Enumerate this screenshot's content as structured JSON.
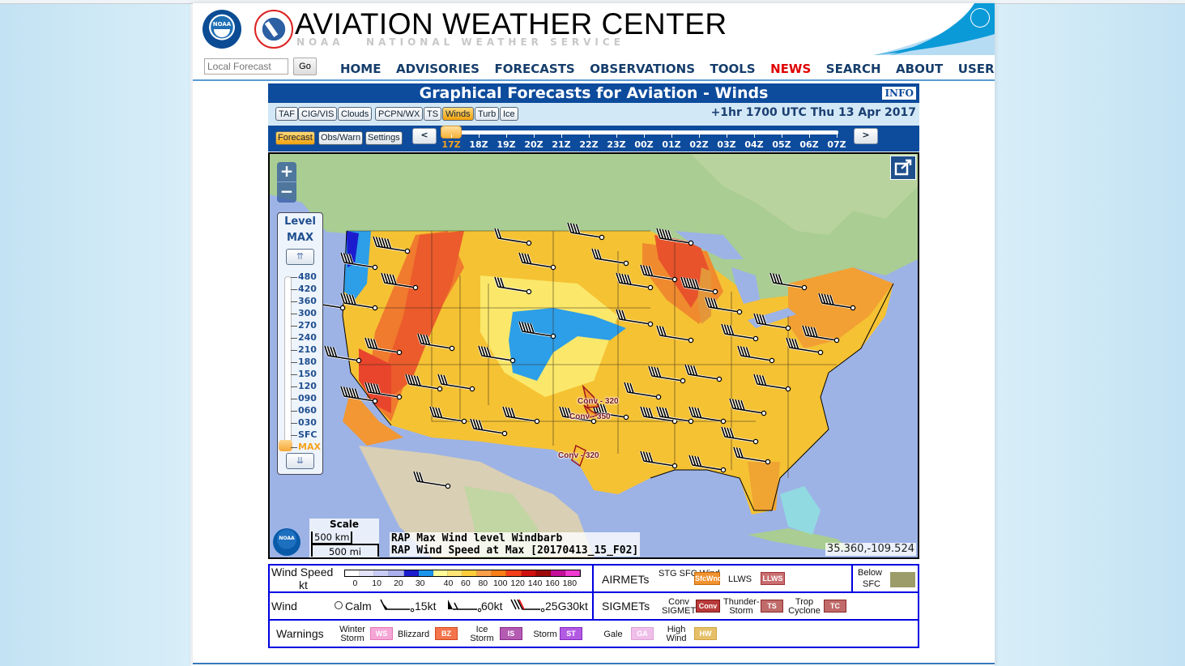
{
  "header": {
    "title": "AVIATION WEATHER CENTER",
    "subtitle": "NOAA   NATIONAL WEATHER SERVICE",
    "noaa_logo_text": "NOAA"
  },
  "nav": {
    "local_forecast_placeholder": "Local Forecast",
    "go_label": "Go",
    "links": [
      "HOME",
      "ADVISORIES",
      "FORECASTS",
      "OBSERVATIONS",
      "TOOLS",
      "NEWS",
      "SEARCH",
      "ABOUT",
      "USER"
    ],
    "highlight_color": "#e00000"
  },
  "tool": {
    "title": "Graphical Forecasts for Aviation - Winds",
    "info_label": "INFO",
    "products": [
      {
        "label": "TAF",
        "active": false
      },
      {
        "label": "CIG/VIS",
        "active": false
      },
      {
        "label": "Clouds",
        "active": false
      },
      {
        "label": "PCPN/WX",
        "active": false
      },
      {
        "label": "TS",
        "active": false
      },
      {
        "label": "Winds",
        "active": true
      },
      {
        "label": "Turb",
        "active": false
      },
      {
        "label": "Ice",
        "active": false
      }
    ],
    "valid_time": "+1hr 1700 UTC Thu 13 Apr 2017",
    "modes": [
      {
        "label": "Forecast",
        "active": true
      },
      {
        "label": "Obs/Warn",
        "active": false
      },
      {
        "label": "Settings",
        "active": false
      }
    ],
    "prev_label": "<",
    "next_label": ">",
    "times": [
      "17Z",
      "18Z",
      "19Z",
      "20Z",
      "21Z",
      "22Z",
      "23Z",
      "00Z",
      "01Z",
      "02Z",
      "03Z",
      "04Z",
      "05Z",
      "06Z",
      "07Z"
    ],
    "selected_time": "17Z"
  },
  "map": {
    "zoom_in": "+",
    "zoom_out": "−",
    "level_panel": {
      "title": "Level",
      "current": "MAX",
      "up_label": "⇈",
      "down_label": "⇊",
      "levels": [
        "480",
        "420",
        "360",
        "300",
        "270",
        "240",
        "210",
        "180",
        "150",
        "120",
        "090",
        "060",
        "030",
        "SFC",
        "MAX"
      ],
      "selected": "MAX"
    },
    "scale": {
      "title": "Scale",
      "km": "500 km",
      "mi": "500 mi"
    },
    "layers": [
      "RAP Max Wind level Windbarb",
      "RAP Wind Speed at Max [20170413_15_F02]"
    ],
    "coordinates": "35.360,-109.524",
    "convective_sigmets": [
      "Conv - 320",
      "Conv - 350",
      "Conv - 320"
    ],
    "noaa_logo_text": "NOAA"
  },
  "legend": {
    "wind_speed": {
      "label_line1": "Wind Speed",
      "label_line2": "kt",
      "colors": [
        "#ffffff",
        "#e3e3fb",
        "#c9cdf5",
        "#abb0ee",
        "#1c1ccf",
        "#1b95ec",
        "#fffd9a",
        "#ffe476",
        "#fdcd3b",
        "#fba049",
        "#f97e17",
        "#f5401c",
        "#d10f0f",
        "#9c0a0a",
        "#c30f9a",
        "#f03ad0"
      ],
      "ticks": [
        "0",
        "10",
        "20",
        "30",
        "40",
        "60",
        "80",
        "100",
        "120",
        "140",
        "160",
        "180"
      ]
    },
    "wind": {
      "label": "Wind",
      "items": [
        "Calm",
        "15kt",
        "60kt",
        "25G30kt"
      ]
    },
    "warnings": {
      "label": "Warnings",
      "items": [
        {
          "name": "Winter Storm",
          "code": "WS",
          "color": "#f5a6d6",
          "border": "#e27ab7"
        },
        {
          "name": "Blizzard",
          "code": "BZ",
          "color": "#f4744c",
          "border": "#d24a1e"
        },
        {
          "name": "Ice Storm",
          "code": "IS",
          "color": "#b45bb2",
          "border": "#8a2b8b"
        },
        {
          "name": "Storm",
          "code": "ST",
          "color": "#b35ae3",
          "border": "#8429c1"
        },
        {
          "name": "Gale",
          "code": "GA",
          "color": "#efbfe9",
          "border": "#dea2d6"
        },
        {
          "name": "High Wind",
          "code": "HW",
          "color": "#e6c068",
          "border": "#d1a444"
        }
      ]
    },
    "airmets": {
      "label": "AIRMETs",
      "items": [
        {
          "name": "STG SFC Wind",
          "code": "SfcWnd",
          "color": "#f0922f",
          "border": "#c86a0a"
        },
        {
          "name": "LLWS",
          "code": "LLWS",
          "color": "#c96e70",
          "border": "#9f3237"
        }
      ]
    },
    "below_sfc": {
      "label_line1": "Below",
      "label_line2": "SFC",
      "color": "#9c9c6a"
    },
    "sigmets": {
      "label": "SIGMETs",
      "items": [
        {
          "name": "Conv SIGMET",
          "code": "Conv",
          "color": "#b93a3a",
          "border": "#7a1515"
        },
        {
          "name": "Thunder-Storm",
          "code": "TS",
          "color": "#c06a6a",
          "border": "#8a2b2b"
        },
        {
          "name": "Trop Cyclone",
          "code": "TC",
          "color": "#c06a6a",
          "border": "#8a2b2b"
        }
      ]
    }
  }
}
